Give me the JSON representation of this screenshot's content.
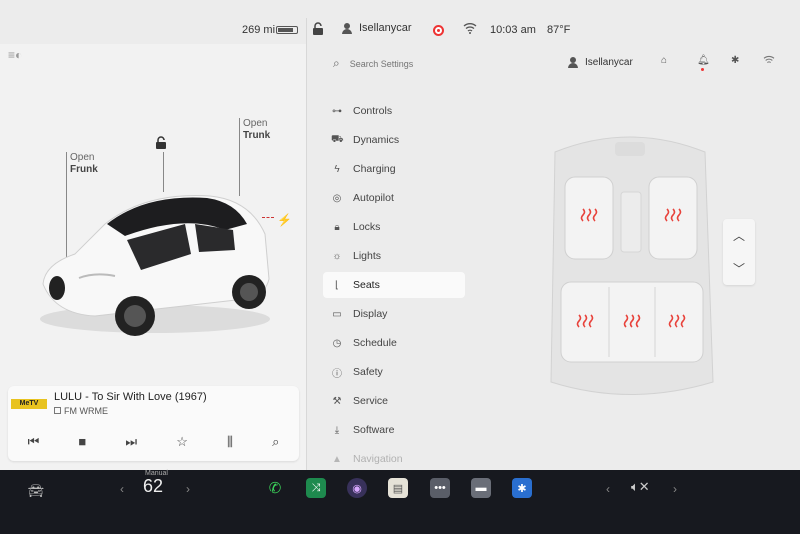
{
  "status": {
    "range": "269 mi",
    "battery_level": 0.85,
    "user": "Isellanycar",
    "time": "10:03 am",
    "temperature": "87°F"
  },
  "car_panel": {
    "frunk_label": "Open",
    "frunk_name": "Frunk",
    "trunk_label": "Open",
    "trunk_name": "Trunk"
  },
  "media": {
    "song": "LULU - To Sir With Love (1967)",
    "station": "FM WRME",
    "logo_text": "MeTV"
  },
  "settings": {
    "search_placeholder": "Search Settings",
    "user": "Isellanycar",
    "menu": [
      {
        "label": "Controls",
        "icon": "toggle-icon"
      },
      {
        "label": "Dynamics",
        "icon": "car-icon"
      },
      {
        "label": "Charging",
        "icon": "bolt-icon"
      },
      {
        "label": "Autopilot",
        "icon": "steering-wheel-icon"
      },
      {
        "label": "Locks",
        "icon": "lock-icon"
      },
      {
        "label": "Lights",
        "icon": "sun-icon"
      },
      {
        "label": "Seats",
        "icon": "seat-icon"
      },
      {
        "label": "Display",
        "icon": "display-icon"
      },
      {
        "label": "Schedule",
        "icon": "clock-icon"
      },
      {
        "label": "Safety",
        "icon": "info-icon"
      },
      {
        "label": "Service",
        "icon": "wrench-icon"
      },
      {
        "label": "Software",
        "icon": "download-icon"
      },
      {
        "label": "Navigation",
        "icon": "navigation-icon"
      }
    ],
    "active_item": "Seats"
  },
  "taskbar": {
    "climate_label": "Manual",
    "climate_value": "62"
  },
  "colors": {
    "heat": "#e8423b",
    "accent_green": "#1e8a4e",
    "bluetooth": "#2a6fd0"
  }
}
